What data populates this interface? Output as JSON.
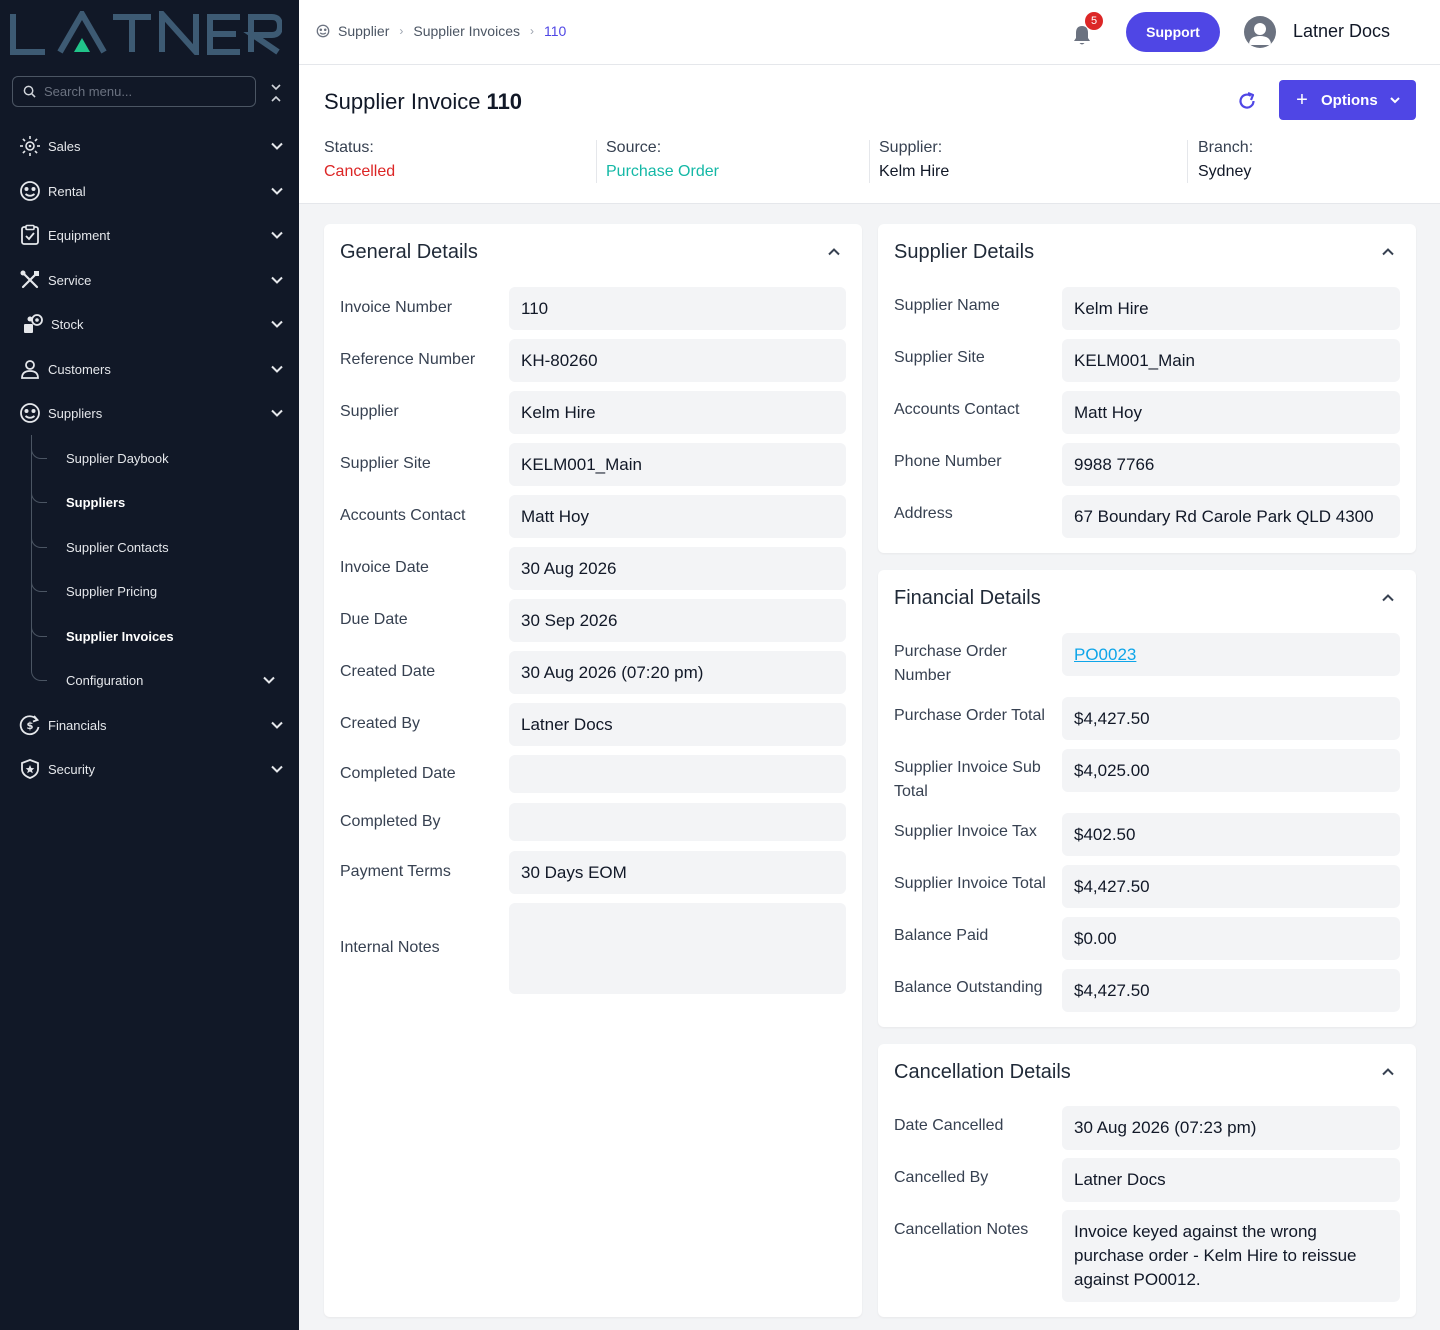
{
  "sidebar": {
    "logo": "LATNER",
    "search_placeholder": "Search menu...",
    "items": [
      {
        "label": "Sales",
        "icon": "sun-gear-icon"
      },
      {
        "label": "Rental",
        "icon": "rental-icon"
      },
      {
        "label": "Equipment",
        "icon": "clipboard-check-icon"
      },
      {
        "label": "Service",
        "icon": "tools-icon"
      },
      {
        "label": "Stock",
        "icon": "stock-icon"
      },
      {
        "label": "Customers",
        "icon": "user-icon"
      },
      {
        "label": "Suppliers",
        "icon": "supplier-icon"
      }
    ],
    "sub_items": [
      {
        "label": "Supplier Daybook"
      },
      {
        "label": "Suppliers"
      },
      {
        "label": "Supplier Contacts"
      },
      {
        "label": "Supplier Pricing"
      },
      {
        "label": "Supplier Invoices"
      },
      {
        "label": "Configuration"
      }
    ],
    "bottom_items": [
      {
        "label": "Financials",
        "icon": "dollar-cycle-icon"
      },
      {
        "label": "Security",
        "icon": "shield-icon"
      }
    ]
  },
  "header": {
    "breadcrumb": [
      "Supplier",
      "Supplier Invoices",
      "110"
    ],
    "notifications": "5",
    "support_label": "Support",
    "user_name": "Latner Docs"
  },
  "page": {
    "title": "Supplier Invoice",
    "number": "110",
    "options_label": "Options",
    "meta": {
      "status_label": "Status:",
      "status_value": "Cancelled",
      "source_label": "Source:",
      "source_value": "Purchase Order",
      "supplier_label": "Supplier:",
      "supplier_value": "Kelm Hire",
      "branch_label": "Branch:",
      "branch_value": "Sydney"
    }
  },
  "general": {
    "title": "General Details",
    "rows": [
      {
        "label": "Invoice Number",
        "value": "110"
      },
      {
        "label": "Reference Number",
        "value": "KH-80260"
      },
      {
        "label": "Supplier",
        "value": "Kelm Hire"
      },
      {
        "label": "Supplier Site",
        "value": "KELM001_Main"
      },
      {
        "label": "Accounts Contact",
        "value": "Matt Hoy"
      },
      {
        "label": "Invoice Date",
        "value": "30 Aug 2026"
      },
      {
        "label": "Due Date",
        "value": "30 Sep 2026"
      },
      {
        "label": "Created Date",
        "value": "30 Aug 2026 (07:20 pm)"
      },
      {
        "label": "Created By",
        "value": "Latner Docs"
      },
      {
        "label": "Completed Date",
        "value": ""
      },
      {
        "label": "Completed By",
        "value": ""
      },
      {
        "label": "Payment Terms",
        "value": "30 Days EOM"
      },
      {
        "label": "Internal Notes",
        "value": ""
      }
    ]
  },
  "supplier_details": {
    "title": "Supplier Details",
    "rows": [
      {
        "label": "Supplier Name",
        "value": "Kelm Hire"
      },
      {
        "label": "Supplier Site",
        "value": "KELM001_Main"
      },
      {
        "label": "Accounts Contact",
        "value": "Matt Hoy"
      },
      {
        "label": "Phone Number",
        "value": "9988 7766"
      },
      {
        "label": "Address",
        "value": "67 Boundary Rd Carole Park QLD 4300"
      }
    ]
  },
  "financial": {
    "title": "Financial Details",
    "rows": [
      {
        "label": "Purchase Order Number",
        "value": "PO0023"
      },
      {
        "label": "Purchase Order Total",
        "value": "$4,427.50"
      },
      {
        "label": "Supplier Invoice Sub Total",
        "value": "$4,025.00"
      },
      {
        "label": "Supplier Invoice Tax",
        "value": "$402.50"
      },
      {
        "label": "Supplier Invoice Total",
        "value": "$4,427.50"
      },
      {
        "label": "Balance Paid",
        "value": "$0.00"
      },
      {
        "label": "Balance Outstanding",
        "value": "$4,427.50"
      }
    ]
  },
  "cancellation": {
    "title": "Cancellation Details",
    "rows": [
      {
        "label": "Date Cancelled",
        "value": "30 Aug 2026 (07:23 pm)"
      },
      {
        "label": "Cancelled By",
        "value": "Latner Docs"
      },
      {
        "label": "Cancellation Notes",
        "value": "Invoice keyed against the wrong purchase order - Kelm Hire to reissue against PO0012."
      }
    ]
  },
  "colors": {
    "sidebar_bg": "#111827",
    "accent": "#4f46e5",
    "status_cancelled": "#dc2626",
    "source_link": "#14b8a6",
    "logo_blue": "#3d5a73",
    "logo_green": "#21c48a"
  }
}
